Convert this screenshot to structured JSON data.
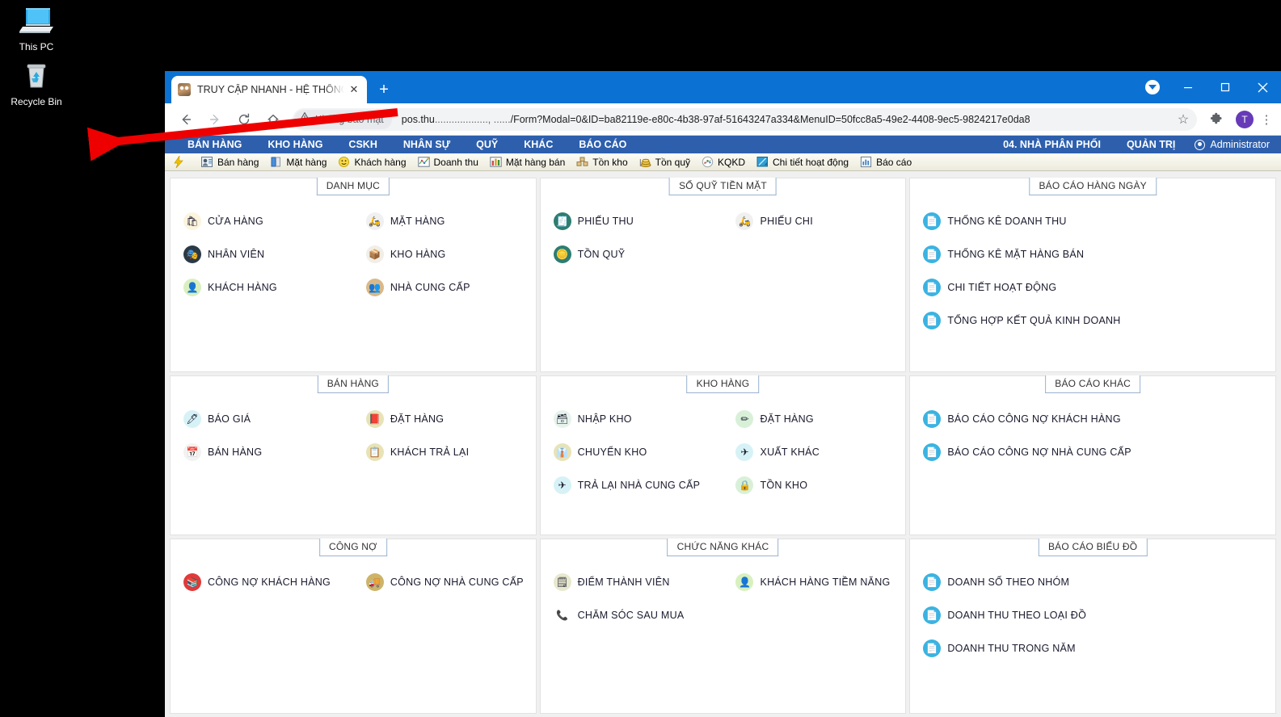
{
  "desktop": {
    "icons": [
      {
        "label": "This PC",
        "icon": "monitor-icon"
      },
      {
        "label": "Recycle Bin",
        "icon": "recycle-bin-icon"
      }
    ]
  },
  "browser": {
    "tab": {
      "title": "TRUY CẬP NHANH - HỆ THỐNG",
      "favicon": "site-favicon",
      "close_label": "✕"
    },
    "new_tab_label": "+",
    "window_controls": {
      "minimize": "—",
      "maximize": "◻",
      "close": "✕"
    },
    "nav": {
      "back": "←",
      "forward": "→",
      "reload": "⟳",
      "home": "⌂"
    },
    "omnibox": {
      "security_label": "Không bảo mật",
      "url_prefix": "pos.thu",
      "url_redacted": "..................., ......",
      "url_suffix": "/Form?Modal=0&ID=ba82119e-e80c-4b38-97af-51643247a334&MenuID=50fcc8a5-49e2-4408-9ec5-9824217e0da8",
      "bookmark": "☆",
      "extensions": "puzzle-icon",
      "avatar_initial": "T",
      "menu": "⋮"
    }
  },
  "app": {
    "menubar": {
      "items": [
        "BÁN HÀNG",
        "KHO HÀNG",
        "CSKH",
        "NHÂN SỰ",
        "QUỸ",
        "KHÁC",
        "BÁO CÁO"
      ],
      "right": {
        "branch": "04. NHÀ PHÂN PHỐI",
        "admin_menu": "QUẢN TRỊ",
        "user": "Administrator"
      }
    },
    "quick_toolbar": [
      {
        "label": "",
        "icon": "lightning-icon"
      },
      {
        "label": "Bán hàng",
        "icon": "salesman-icon"
      },
      {
        "label": "Mặt hàng",
        "icon": "product-icon"
      },
      {
        "label": "Khách hàng",
        "icon": "customer-icon"
      },
      {
        "label": "Doanh thu",
        "icon": "revenue-icon"
      },
      {
        "label": "Mặt hàng bán",
        "icon": "bar-chart-icon"
      },
      {
        "label": "Tồn kho",
        "icon": "boxes-icon"
      },
      {
        "label": "Tồn quỹ",
        "icon": "coins-icon"
      },
      {
        "label": "KQKD",
        "icon": "scatter-icon"
      },
      {
        "label": "Chi tiết hoạt động",
        "icon": "activity-icon"
      },
      {
        "label": "Báo cáo",
        "icon": "report-icon"
      }
    ],
    "panels": [
      {
        "title": "DANH MỤC",
        "items": [
          {
            "label": "CỬA HÀNG",
            "icon": "shop-bag-icon",
            "bg": "#fdf4de",
            "fg": "#e8b340",
            "glyph": "🛍"
          },
          {
            "label": "MẶT HÀNG",
            "icon": "scooter-icon",
            "bg": "#f0f0f0",
            "fg": "#e03a3a",
            "glyph": "🛵"
          },
          {
            "label": "NHÂN VIÊN",
            "icon": "masks-icon",
            "bg": "#2b3a45",
            "fg": "#ffffff",
            "glyph": "🎭"
          },
          {
            "label": "KHO HÀNG",
            "icon": "package-icon",
            "bg": "#f1eee7",
            "fg": "#d8a54a",
            "glyph": "📦"
          },
          {
            "label": "KHÁCH HÀNG",
            "icon": "person-green-icon",
            "bg": "#d8f0bf",
            "fg": "#3b7a2a",
            "glyph": "👤"
          },
          {
            "label": "NHÀ CUNG CẤP",
            "icon": "group-icon",
            "bg": "#d9b98a",
            "fg": "#5a3a1e",
            "glyph": "👥"
          }
        ]
      },
      {
        "title": "SỔ QUỸ TIỀN MẶT",
        "items": [
          {
            "label": "PHIẾU THU",
            "icon": "receipt-icon",
            "bg": "#2e7d70",
            "fg": "#f2f2ee",
            "glyph": "🧾"
          },
          {
            "label": "PHIẾU CHI",
            "icon": "scooter-icon",
            "bg": "#f0f0f0",
            "fg": "#e03a3a",
            "glyph": "🛵"
          },
          {
            "label": "TỒN QUỸ",
            "icon": "coins-icon",
            "bg": "#2e7d70",
            "fg": "#d9a441",
            "glyph": "🪙"
          }
        ]
      },
      {
        "title": "BÁO CÁO HÀNG NGÀY",
        "items": [
          {
            "label": "THỐNG KÊ DOANH THU",
            "icon": "document-icon",
            "bg": "#3bb3e0",
            "fg": "#ffffff",
            "glyph": "📄"
          },
          {
            "label": "THỐNG KÊ MẶT HÀNG BÁN",
            "icon": "document-icon",
            "bg": "#3bb3e0",
            "fg": "#ffffff",
            "glyph": "📄"
          },
          {
            "label": "CHI TIẾT HOẠT ĐỘNG",
            "icon": "document-icon",
            "bg": "#3bb3e0",
            "fg": "#ffffff",
            "glyph": "📄"
          },
          {
            "label": "TỔNG HỢP KẾT QUẢ KINH DOANH",
            "icon": "document-icon",
            "bg": "#3bb3e0",
            "fg": "#ffffff",
            "glyph": "📄"
          }
        ]
      },
      {
        "title": "BÁN HÀNG",
        "items": [
          {
            "label": "BÁO GIÁ",
            "icon": "pen-icon",
            "bg": "#d6f2f6",
            "fg": "#e0a020",
            "glyph": "🖊"
          },
          {
            "label": "ĐẶT HÀNG",
            "icon": "book-icon",
            "bg": "#e8e3b6",
            "fg": "#8c2f2f",
            "glyph": "📕"
          },
          {
            "label": "BÁN HÀNG",
            "icon": "calendar-icon",
            "bg": "#f2f2f2",
            "fg": "#c0392b",
            "glyph": "📅"
          },
          {
            "label": "KHÁCH TRẢ LẠI",
            "icon": "clipboard-icon",
            "bg": "#e8e3b6",
            "fg": "#4a5a6a",
            "glyph": "📋"
          }
        ]
      },
      {
        "title": "KHO HÀNG",
        "items": [
          {
            "label": "NHẬP KHO",
            "icon": "tray-icon",
            "bg": "#e6f3ec",
            "fg": "#d8b14a",
            "glyph": "🗃"
          },
          {
            "label": "ĐẶT HÀNG",
            "icon": "pencil-icon",
            "bg": "#d8f0d8",
            "fg": "#c0392b",
            "glyph": "✏"
          },
          {
            "label": "CHUYỂN KHO",
            "icon": "tie-icon",
            "bg": "#e8e3b6",
            "fg": "#c0392b",
            "glyph": "👔"
          },
          {
            "label": "XUẤT KHÁC",
            "icon": "paper-plane-icon",
            "bg": "#d6f2f6",
            "fg": "#7a8a99",
            "glyph": "✈"
          },
          {
            "label": "TRẢ LẠI NHÀ CUNG CẤP",
            "icon": "paper-plane-icon",
            "bg": "#d6f2f6",
            "fg": "#7a8a99",
            "glyph": "✈"
          },
          {
            "label": "TỒN KHO",
            "icon": "lock-icon",
            "bg": "#d8f0d8",
            "fg": "#c0392b",
            "glyph": "🔒"
          }
        ]
      },
      {
        "title": "BÁO CÁO KHÁC",
        "items": [
          {
            "label": "BÁO CÁO CÔNG NỢ KHÁCH HÀNG",
            "icon": "document-icon",
            "bg": "#3bb3e0",
            "fg": "#ffffff",
            "glyph": "📄"
          },
          {
            "label": "BÁO CÁO CÔNG NỢ NHÀ CUNG CẤP",
            "icon": "document-icon",
            "bg": "#3bb3e0",
            "fg": "#ffffff",
            "glyph": "📄"
          }
        ]
      },
      {
        "title": "CÔNG NỢ",
        "items": [
          {
            "label": "CÔNG NỢ KHÁCH HÀNG",
            "icon": "books-icon",
            "bg": "#e03a3a",
            "fg": "#ffffff",
            "glyph": "📚"
          },
          {
            "label": "CÔNG NỢ NHÀ CUNG CẤP",
            "icon": "truck-icon",
            "bg": "#cdb469",
            "fg": "#333333",
            "glyph": "🚚"
          }
        ]
      },
      {
        "title": "CHỨC NĂNG KHÁC",
        "items": [
          {
            "label": "ĐIỂM THÀNH VIÊN",
            "icon": "list-card-icon",
            "bg": "#e8e8cf",
            "fg": "#2e7d70",
            "glyph": "🗒"
          },
          {
            "label": "KHÁCH HÀNG TIỀM NĂNG",
            "icon": "person-green-icon",
            "bg": "#d8f0bf",
            "fg": "#3b7a2a",
            "glyph": "👤"
          },
          {
            "label": "CHĂM SÓC SAU MUA",
            "icon": "phone-support-icon",
            "bg": "#ffffff",
            "fg": "#1a2a3a",
            "glyph": "📞"
          }
        ]
      },
      {
        "title": "BÁO CÁO BIỂU ĐỒ",
        "items": [
          {
            "label": "DOANH SỐ THEO NHÓM",
            "icon": "document-icon",
            "bg": "#3bb3e0",
            "fg": "#ffffff",
            "glyph": "📄"
          },
          {
            "label": "DOANH THU THEO LOẠI ĐỒ",
            "icon": "document-icon",
            "bg": "#3bb3e0",
            "fg": "#ffffff",
            "glyph": "📄"
          },
          {
            "label": "DOANH THU TRONG NĂM",
            "icon": "document-icon",
            "bg": "#3bb3e0",
            "fg": "#ffffff",
            "glyph": "📄"
          }
        ]
      }
    ]
  },
  "annotation": {
    "type": "red-arrow",
    "color": "#ee0000",
    "points_from": "security-chip",
    "points_to": "desktop-left"
  }
}
